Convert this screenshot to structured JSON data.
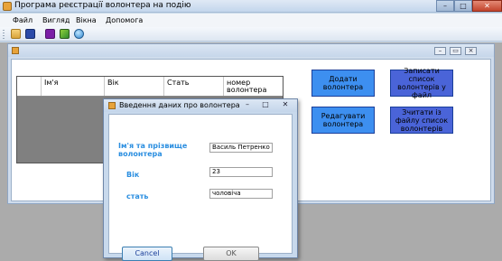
{
  "window": {
    "title": "Програма реєстрації волонтера на подію",
    "controls": {
      "minimize": "–",
      "maximize": "□",
      "close": "✕"
    }
  },
  "menu": {
    "items": [
      "Файл",
      "Вигляд",
      "Вікна",
      "Допомога"
    ]
  },
  "toolbar": {
    "tools": [
      "open-folder-icon",
      "save-icon",
      "purple-tool-icon",
      "green-tool-icon",
      "globe-icon"
    ]
  },
  "child_window": {
    "controls": {
      "minimize": "–",
      "restore": "▭",
      "close": "×"
    }
  },
  "grid": {
    "columns": [
      "",
      "Ім'я",
      "Вік",
      "Стать",
      "номер волонтера"
    ]
  },
  "actions": {
    "add": "Додати волонтера",
    "save_list": "Записати список волонтерів у файл",
    "edit": "Редагувати волонтера",
    "read_list": "Зчитати із файлу список волонтерів"
  },
  "dialog": {
    "title": "Введення даних про волонтера",
    "controls": {
      "minimize": "–",
      "maximize": "□",
      "close": "✕"
    },
    "name_label": "Ім'я та прізвище волонтера",
    "name_value": "Василь Петренко",
    "age_label": "Вік",
    "age_value": "23",
    "gender_label": "стать",
    "gender_value": "чоловіча",
    "cancel": "Cancel",
    "ok": "OK"
  },
  "colors": {
    "accent_label": "#2a8ee0",
    "button_bright": "#3d8ff0",
    "button_dim": "#4a64d8"
  }
}
